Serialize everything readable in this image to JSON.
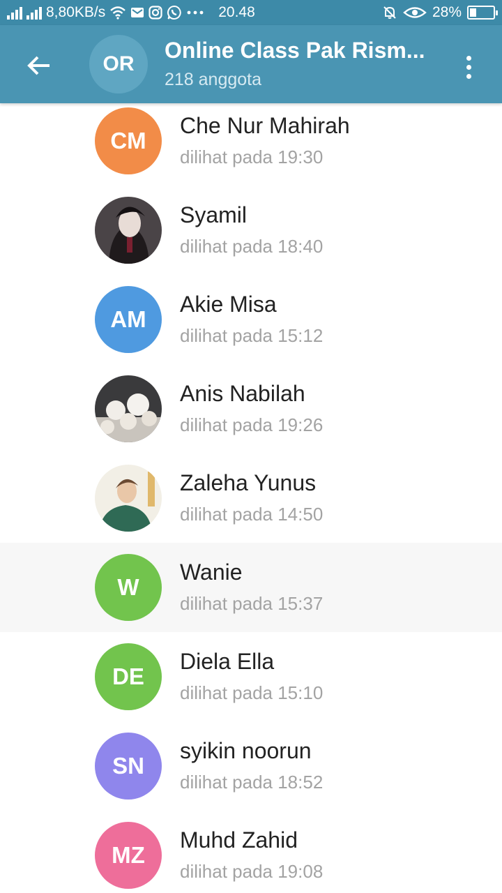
{
  "status_bar": {
    "speed": "8,80KB/s",
    "time": "20.48",
    "battery": "28%",
    "battery_level": 0.28,
    "icons": [
      "signal-icon",
      "signal-icon",
      "wifi-icon",
      "mail-icon",
      "instagram-icon",
      "whatsapp-icon",
      "more-dots-icon",
      "bell-off-icon",
      "eye-icon",
      "battery-icon"
    ]
  },
  "header": {
    "avatar_initials": "OR",
    "title": "Online Class Pak Rism...",
    "subtitle": "218 anggota",
    "back_icon": "back-arrow-icon",
    "menu_icon": "more-vert-icon"
  },
  "members": [
    {
      "name": "Che Nur Mahirah",
      "seen": "dilihat pada 19:30",
      "initials": "CM",
      "color": "#f28c48",
      "photo": false
    },
    {
      "name": "Syamil",
      "seen": "dilihat pada 18:40",
      "initials": "",
      "color": "#3a3538",
      "photo": true
    },
    {
      "name": "Akie Misa",
      "seen": "dilihat pada 15:12",
      "initials": "AM",
      "color": "#4f9ae0",
      "photo": false
    },
    {
      "name": "Anis Nabilah",
      "seen": "dilihat pada 19:26",
      "initials": "",
      "color": "#d9d4cc",
      "photo": true
    },
    {
      "name": "Zaleha Yunus",
      "seen": "dilihat pada 14:50",
      "initials": "",
      "color": "#3b6b58",
      "photo": true
    },
    {
      "name": "Wanie",
      "seen": "dilihat pada 15:37",
      "initials": "W",
      "color": "#72c44d",
      "photo": false
    },
    {
      "name": "Diela Ella",
      "seen": "dilihat pada 15:10",
      "initials": "DE",
      "color": "#72c44d",
      "photo": false
    },
    {
      "name": "syikin noorun",
      "seen": "dilihat pada 18:52",
      "initials": "SN",
      "color": "#8f86ec",
      "photo": false
    },
    {
      "name": "Muhd Zahid",
      "seen": "dilihat pada 19:08",
      "initials": "MZ",
      "color": "#ee6e9a",
      "photo": false
    }
  ]
}
